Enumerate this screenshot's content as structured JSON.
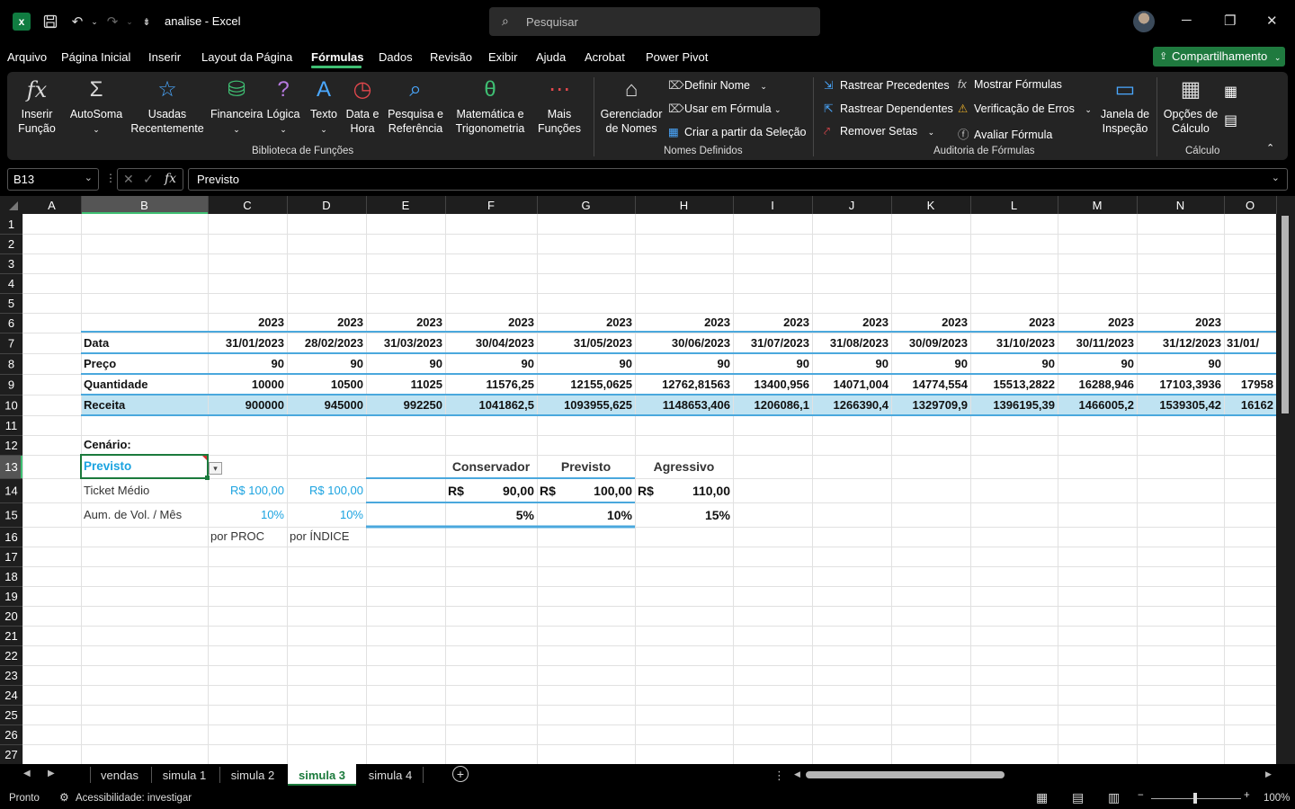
{
  "titlebar": {
    "doc_title": "analise  -  Excel",
    "search_placeholder": "Pesquisar",
    "app_icon": "excel-icon"
  },
  "menu": [
    "Arquivo",
    "Página Inicial",
    "Inserir",
    "Layout da Página",
    "Fórmulas",
    "Dados",
    "Revisão",
    "Exibir",
    "Ajuda",
    "Acrobat",
    "Power Pivot"
  ],
  "share_label": "Compartilhamento",
  "ribbon": {
    "insert_function": "Inserir\nFunção",
    "autosum": "AutoSoma",
    "recent": "Usadas\nRecentemente",
    "financial": "Financeira",
    "logical": "Lógica",
    "text": "Texto",
    "datetime": "Data e\nHora",
    "lookup": "Pesquisa e\nReferência",
    "math": "Matemática e\nTrigonometria",
    "more": "Mais\nFunções",
    "name_manager": "Gerenciador\nde Nomes",
    "define_name": "Definir Nome",
    "use_in_formula": "Usar em Fórmula",
    "create_from_selection": "Criar a partir da Seleção",
    "trace_precedents": "Rastrear Precedentes",
    "trace_dependents": "Rastrear Dependentes",
    "remove_arrows": "Remover Setas",
    "show_formulas": "Mostrar Fórmulas",
    "error_checking": "Verificação de Erros",
    "evaluate_formula": "Avaliar Fórmula",
    "watch_window": "Janela de\nInspeção",
    "calc_options": "Opções de\nCálculo",
    "groups": {
      "library": "Biblioteca de Funções",
      "names": "Nomes Definidos",
      "audit": "Auditoria de Fórmulas",
      "calc": "Cálculo"
    }
  },
  "formula_bar": {
    "name_box": "B13",
    "content": "Previsto"
  },
  "columns": [
    "A",
    "B",
    "C",
    "D",
    "E",
    "F",
    "G",
    "H",
    "I",
    "J",
    "K",
    "L",
    "M",
    "N",
    "O"
  ],
  "rows": [
    "1",
    "2",
    "3",
    "4",
    "5",
    "6",
    "7",
    "8",
    "9",
    "10",
    "11",
    "12",
    "13",
    "14",
    "15",
    "16",
    "17",
    "18",
    "19",
    "20",
    "21",
    "22",
    "23",
    "24",
    "25",
    "26",
    "27"
  ],
  "table": {
    "years": [
      "2023",
      "2023",
      "2023",
      "2023",
      "2023",
      "2023",
      "2023",
      "2023",
      "2023",
      "2023",
      "2023",
      "2023"
    ],
    "labels": {
      "date": "Data",
      "price": "Preço",
      "qty": "Quantidade",
      "revenue": "Receita"
    },
    "dates": [
      "31/01/2023",
      "28/02/2023",
      "31/03/2023",
      "30/04/2023",
      "31/05/2023",
      "30/06/2023",
      "31/07/2023",
      "31/08/2023",
      "30/09/2023",
      "31/10/2023",
      "30/11/2023",
      "31/12/2023",
      "31/01/"
    ],
    "prices": [
      "90",
      "90",
      "90",
      "90",
      "90",
      "90",
      "90",
      "90",
      "90",
      "90",
      "90",
      "90"
    ],
    "quantities": [
      "10000",
      "10500",
      "11025",
      "11576,25",
      "12155,0625",
      "12762,81563",
      "13400,956",
      "14071,004",
      "14774,554",
      "15513,2822",
      "16288,946",
      "17103,3936",
      "17958"
    ],
    "revenues": [
      "900000",
      "945000",
      "992250",
      "1041862,5",
      "1093955,625",
      "1148653,406",
      "1206086,1",
      "1266390,4",
      "1329709,9",
      "1396195,39",
      "1466005,2",
      "1539305,42",
      "16162"
    ]
  },
  "scenario": {
    "label": "Cenário:",
    "selected": "Previsto",
    "ticket_label": "Ticket Médio",
    "ticket_c": "R$   100,00",
    "ticket_d": "R$   100,00",
    "vol_label": "Aum. de Vol. / Mês",
    "vol_c": "10%",
    "vol_d": "10%",
    "method_c": "por PROC",
    "method_d": "por ÍNDICE"
  },
  "scen_table": {
    "headers": [
      "Conservador",
      "Previsto",
      "Agressivo"
    ],
    "currency": "R$",
    "prices": [
      "90,00",
      "100,00",
      "110,00"
    ],
    "pcts": [
      "5%",
      "10%",
      "15%"
    ]
  },
  "sheets": [
    "vendas",
    "simula 1",
    "simula 2",
    "simula 3",
    "simula 4"
  ],
  "status": {
    "ready": "Pronto",
    "accessibility": "Acessibilidade: investigar",
    "zoom": "100%"
  }
}
